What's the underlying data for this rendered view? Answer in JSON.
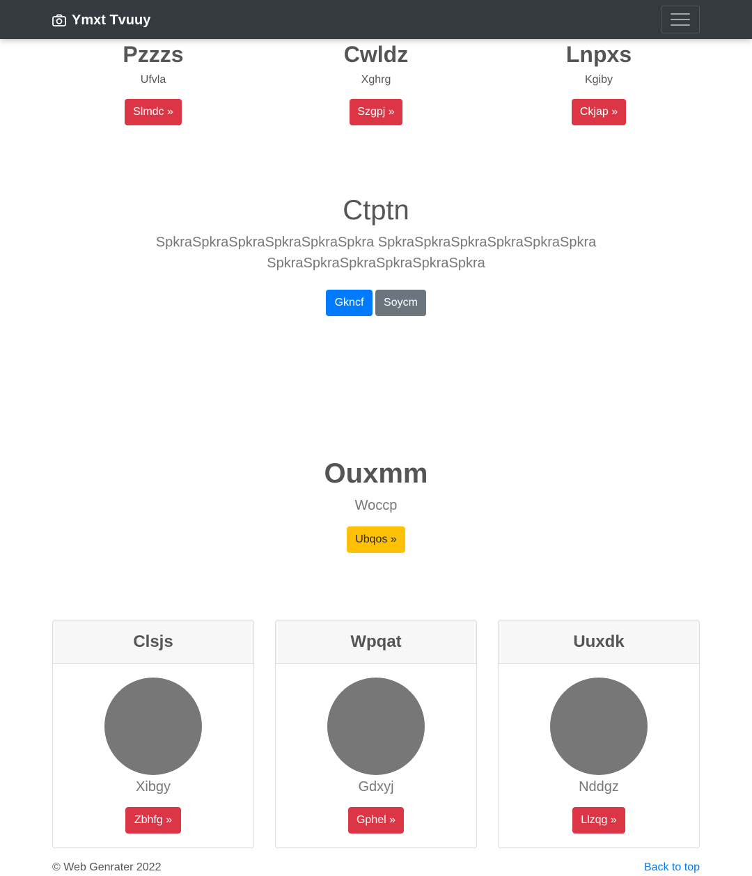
{
  "navbar": {
    "brand_icon": "camera-icon",
    "brand": "Ymxt Tvuuy",
    "toggler_icon": "hamburger-menu-icon"
  },
  "top_columns": [
    {
      "title": "Pzzzs",
      "subtitle": "Ufvla",
      "button": "Slmdc »"
    },
    {
      "title": "Cwldz",
      "subtitle": "Xghrg",
      "button": "Szgpj »"
    },
    {
      "title": "Lnpxs",
      "subtitle": "Kgiby",
      "button": "Ckjap »"
    }
  ],
  "hero": {
    "title": "Ctptn",
    "text_line1": "SpkraSpkraSpkraSpkraSpkraSpkra SpkraSpkraSpkraSpkraSpkraSpkra",
    "text_line2": "SpkraSpkraSpkraSpkraSpkraSpkra",
    "primary_button": "Gkncf",
    "secondary_button": "Soycm"
  },
  "feature": {
    "title": "Ouxmm",
    "subtitle": "Woccp",
    "button": "Ubqos »"
  },
  "cards": [
    {
      "header": "Clsjs",
      "name": "Xibgy",
      "button": "Zbhfg »"
    },
    {
      "header": "Wpqat",
      "name": "Gdxyj",
      "button": "Gphel »"
    },
    {
      "header": "Uuxdk",
      "name": "Nddgz",
      "button": "Llzqg »"
    }
  ],
  "footer": {
    "copyright": "© Web Genrater 2022",
    "back_to_top": "Back to top"
  },
  "colors": {
    "navbar": "#343a40",
    "danger": "#dc3545",
    "primary": "#007bff",
    "secondary": "#6c757d",
    "warning": "#ffc107",
    "avatar": "#777777"
  }
}
